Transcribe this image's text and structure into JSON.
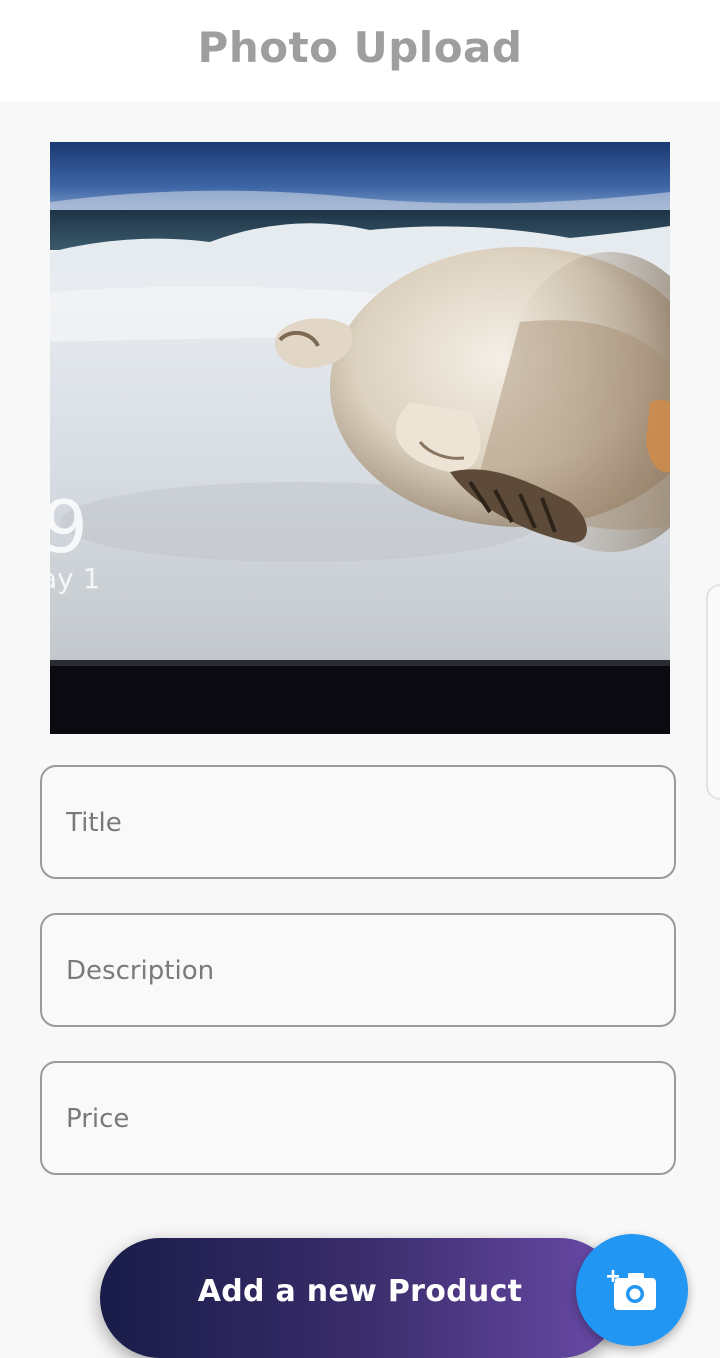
{
  "header": {
    "title": "Photo Upload"
  },
  "photo": {
    "alt": "Seal lying on snow"
  },
  "form": {
    "title_placeholder": "Title",
    "title_value": "",
    "description_placeholder": "Description",
    "description_value": "",
    "price_placeholder": "Price",
    "price_value": ""
  },
  "actions": {
    "add_label": "Add a new Product",
    "camera_icon": "add-a-photo-icon"
  },
  "colors": {
    "header_text": "#9e9e9e",
    "fab": "#2196f3",
    "button_gradient_start": "#181c48",
    "button_gradient_end": "#6a4aa8"
  }
}
